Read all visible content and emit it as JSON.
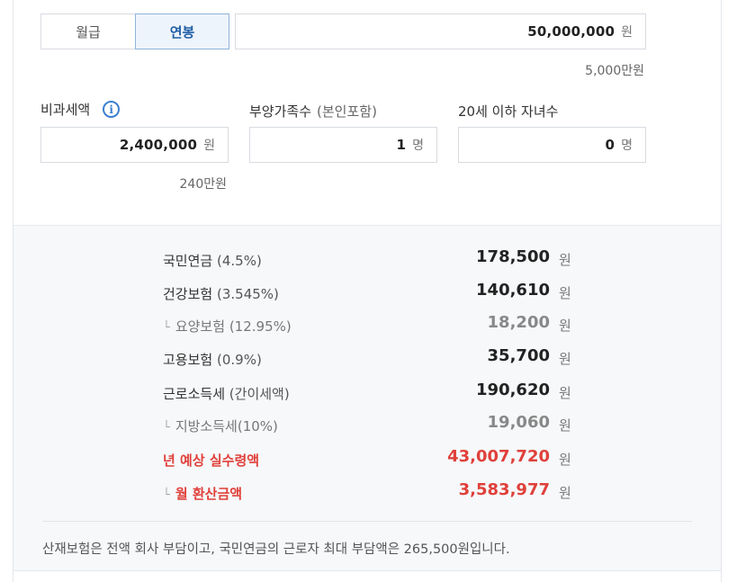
{
  "pay_type_tabs": [
    {
      "label": "월급",
      "selected": false
    },
    {
      "label": "연봉",
      "selected": true
    }
  ],
  "salary": {
    "value": "50,000,000",
    "unit": "원",
    "hint": "5,000만원"
  },
  "non_taxable": {
    "label": "비과세액",
    "info_icon": "info-icon",
    "value": "2,400,000",
    "unit": "원",
    "hint": "240만원"
  },
  "dependents": {
    "label": "부양가족수",
    "label_sub": "(본인포함)",
    "value": "1",
    "unit": "명"
  },
  "children": {
    "label": "20세 이하 자녀수",
    "value": "0",
    "unit": "명"
  },
  "results": [
    {
      "name": "국민연금",
      "paren": "(4.5%)",
      "amount": "178,500",
      "unit": "원",
      "sub": false,
      "highlight": false
    },
    {
      "name": "건강보험",
      "paren": "(3.545%)",
      "amount": "140,610",
      "unit": "원",
      "sub": false,
      "highlight": false
    },
    {
      "name": "요양보험",
      "paren": "(12.95%)",
      "amount": "18,200",
      "unit": "원",
      "sub": true,
      "highlight": false
    },
    {
      "name": "고용보험",
      "paren": "(0.9%)",
      "amount": "35,700",
      "unit": "원",
      "sub": false,
      "highlight": false
    },
    {
      "name": "근로소득세",
      "paren": "(간이세액)",
      "amount": "190,620",
      "unit": "원",
      "sub": false,
      "highlight": false
    },
    {
      "name": "지방소득세",
      "paren": "(10%)",
      "amount": "19,060",
      "unit": "원",
      "sub": true,
      "highlight": false
    },
    {
      "name": "년 예상 실수령액",
      "paren": "",
      "amount": "43,007,720",
      "unit": "원",
      "sub": false,
      "highlight": true
    },
    {
      "name": "월 환산금액",
      "paren": "",
      "amount": "3,583,977",
      "unit": "원",
      "sub": true,
      "highlight": true
    }
  ],
  "branch_glyph": "└",
  "note": "산재보험은 전액 회사 부담이고, 국민연금의 근로자 최대 부담액은 265,500원입니다.",
  "colors": {
    "accent": "#1f5fa6",
    "info": "#3b7fd1",
    "highlight": "#e0403a",
    "result_bg": "#f6f8fa"
  }
}
